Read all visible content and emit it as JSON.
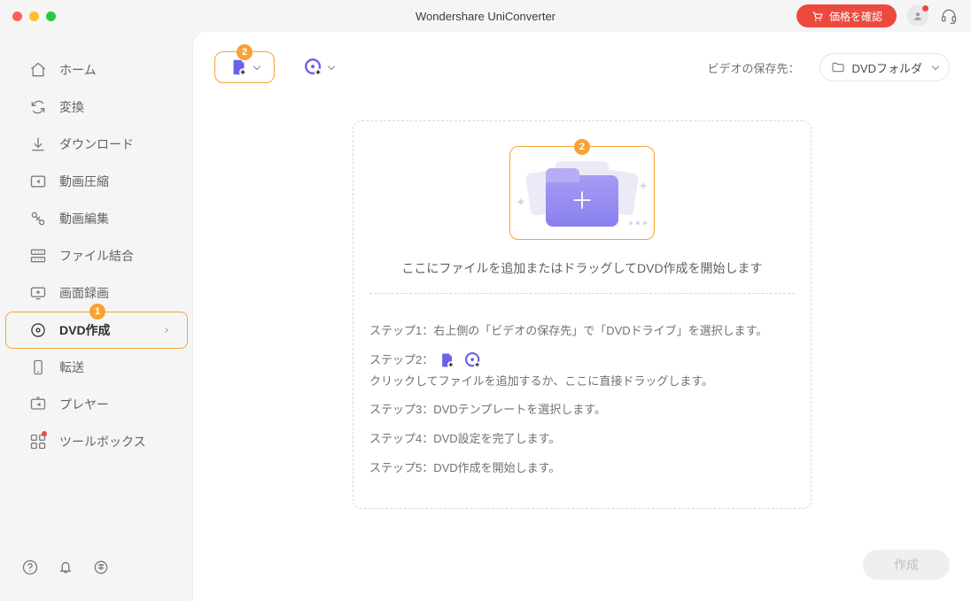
{
  "app": {
    "title": "Wondershare UniConverter"
  },
  "header": {
    "price_label": "価格を確認"
  },
  "sidebar": {
    "items": [
      {
        "label": "ホーム"
      },
      {
        "label": "変換"
      },
      {
        "label": "ダウンロード"
      },
      {
        "label": "動画圧縮"
      },
      {
        "label": "動画編集"
      },
      {
        "label": "ファイル結合"
      },
      {
        "label": "画面録画"
      },
      {
        "label": "DVD作成",
        "badge": "1"
      },
      {
        "label": "転送"
      },
      {
        "label": "プレヤー"
      },
      {
        "label": "ツールボックス"
      }
    ]
  },
  "toolbar": {
    "add_file_badge": "2",
    "save_label": "ビデオの保存先：",
    "save_value": "DVDフォルダ"
  },
  "drop": {
    "badge": "2",
    "title": "ここにファイルを追加またはドラッグしてDVD作成を開始します",
    "steps": {
      "s1": "ステップ1：右上側の「ビデオの保存先」で「DVDドライブ」を選択します。",
      "s2a": "ステップ2：",
      "s2b": "クリックしてファイルを追加するか、ここに直接ドラッグします。",
      "s3": "ステップ3：DVDテンプレートを選択します。",
      "s4": "ステップ4：DVD設定を完了します。",
      "s5": "ステップ5：DVD作成を開始します。"
    }
  },
  "actions": {
    "create": "作成"
  }
}
